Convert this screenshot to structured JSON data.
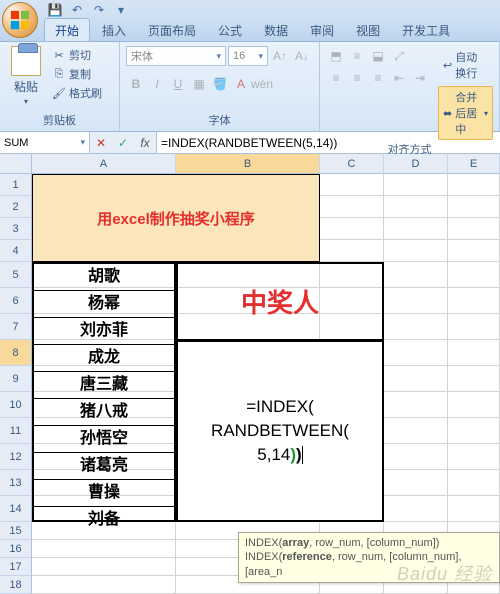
{
  "qat": {
    "save": "💾",
    "undo": "↶",
    "redo": "↷"
  },
  "tabs": [
    "开始",
    "插入",
    "页面布局",
    "公式",
    "数据",
    "审阅",
    "视图",
    "开发工具"
  ],
  "active_tab": 0,
  "ribbon": {
    "clipboard": {
      "paste": "粘贴",
      "cut": "剪切",
      "copy": "复制",
      "format": "格式刷",
      "label": "剪贴板"
    },
    "font": {
      "name": "宋体",
      "size": "16",
      "label": "字体"
    },
    "align": {
      "wrap": "自动换行",
      "merge": "合并后居中",
      "label": "对齐方式"
    }
  },
  "cellref": "SUM",
  "formula": "=INDEX(RANDBETWEEN(5,14))",
  "columns": [
    "A",
    "B",
    "C",
    "D",
    "E"
  ],
  "row_count": 18,
  "title_cell": "用excel制作抽奖小程序",
  "names": [
    "胡歌",
    "杨幂",
    "刘亦菲",
    "成龙",
    "唐三藏",
    "猪八戒",
    "孙悟空",
    "诸葛亮",
    "曹操",
    "刘备"
  ],
  "winner_label": "中奖人",
  "editing_formula": {
    "l1": "=INDEX(",
    "l2": "RANDBETWEEN(",
    "l3_num": "5,14",
    "l3_close_inner": ")",
    "l3_close_outer": ")"
  },
  "tooltip": {
    "line1_pre": "INDEX(",
    "line1_bold": "array",
    "line1_post": ", row_num, [column_num])",
    "line2_pre": "INDEX(",
    "line2_bold": "reference",
    "line2_post": ", row_num, [column_num], [area_n"
  },
  "watermark": "Baidu 经验"
}
